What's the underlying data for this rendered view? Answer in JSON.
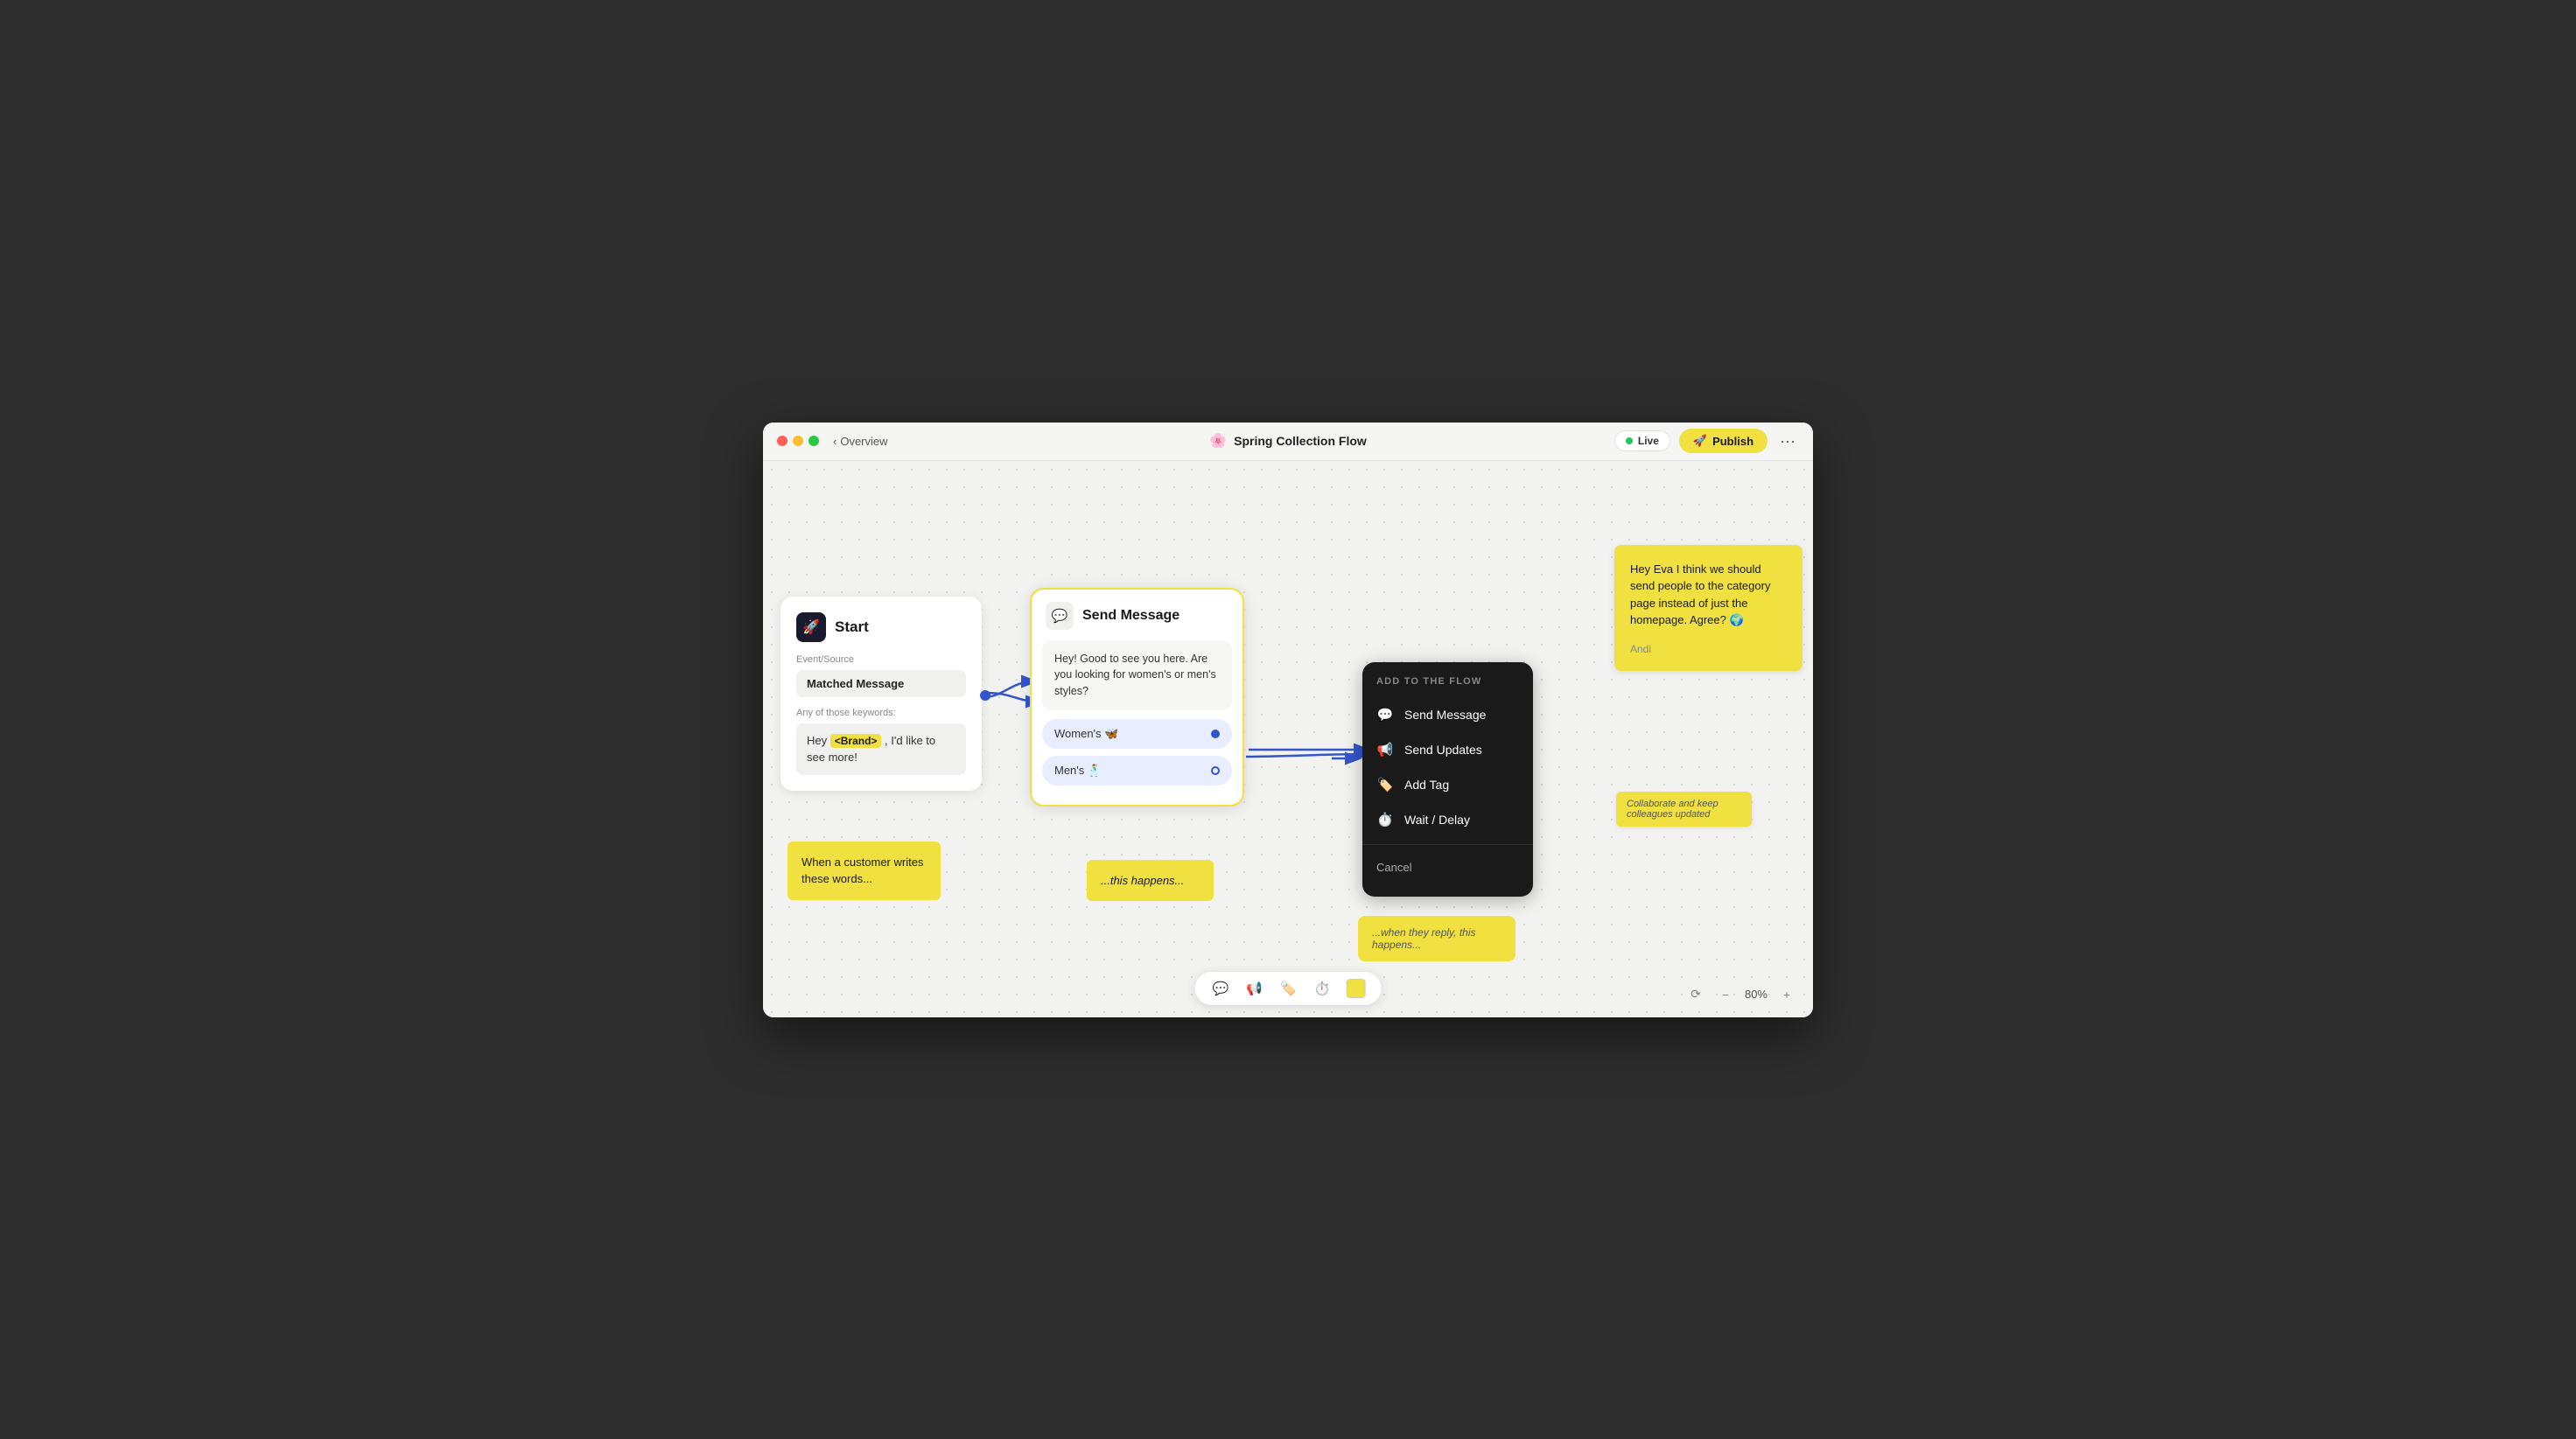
{
  "window": {
    "titlebar": {
      "back_label": "Overview",
      "flow_name": "Spring Collection Flow",
      "flow_emoji": "🌸",
      "live_label": "Live",
      "publish_label": "Publish"
    }
  },
  "start_node": {
    "title": "Start",
    "icon": "🚀",
    "event_label": "Event/Source",
    "event_value": "Matched Message",
    "keywords_label": "Any of those keywords:",
    "keyword_text_before": "Hey ",
    "keyword_brand": "<Brand>",
    "keyword_text_after": " , I'd like to see more!"
  },
  "message_node": {
    "title": "Send Message",
    "icon": "💬",
    "body_text": "Hey! Good to see you here. Are you looking for women's or men's styles?",
    "choice_1": "Women's 🦋",
    "choice_2": "Men's 🕺"
  },
  "add_flow_menu": {
    "title": "ADD TO THE FLOW",
    "items": [
      {
        "label": "Send Message",
        "icon": "💬"
      },
      {
        "label": "Send Updates",
        "icon": "📢"
      },
      {
        "label": "Add Tag",
        "icon": "🏷️"
      },
      {
        "label": "Wait / Delay",
        "icon": "⏱️"
      }
    ],
    "cancel_label": "Cancel"
  },
  "sticky_notes": {
    "when_customer": "When a customer writes these words...",
    "this_happens": "...this happens...",
    "when_reply": "...when they reply, this happens...",
    "collaborate": "Collaborate and keep colleagues updated"
  },
  "comment_note": {
    "text": "Hey Eva I think we should send people to the category page instead of just the homepage. Agree? 🌍",
    "author": "Andi"
  },
  "zoom": {
    "level": "80%"
  },
  "toolbar": {
    "icons": [
      "💬",
      "📢",
      "🏷️",
      "⏱️"
    ]
  }
}
